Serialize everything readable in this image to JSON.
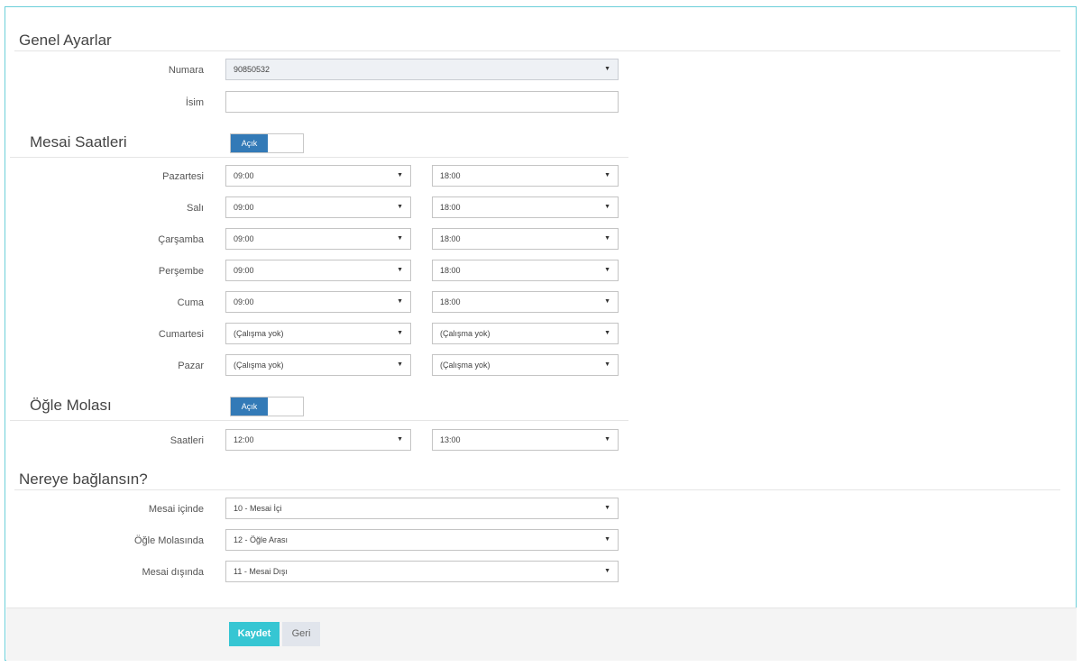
{
  "general": {
    "title": "Genel Ayarlar",
    "number_label": "Numara",
    "number_value": "90850532",
    "name_label": "İsim",
    "name_value": ""
  },
  "hours": {
    "title": "Mesai Saatleri",
    "toggle_label": "Açık",
    "days": [
      {
        "label": "Pazartesi",
        "start": "09:00",
        "end": "18:00"
      },
      {
        "label": "Salı",
        "start": "09:00",
        "end": "18:00"
      },
      {
        "label": "Çarşamba",
        "start": "09:00",
        "end": "18:00"
      },
      {
        "label": "Perşembe",
        "start": "09:00",
        "end": "18:00"
      },
      {
        "label": "Cuma",
        "start": "09:00",
        "end": "18:00"
      },
      {
        "label": "Cumartesi",
        "start": "(Çalışma yok)",
        "end": "(Çalışma yok)"
      },
      {
        "label": "Pazar",
        "start": "(Çalışma yok)",
        "end": "(Çalışma yok)"
      }
    ]
  },
  "lunch": {
    "title": "Öğle Molası",
    "toggle_label": "Açık",
    "hours_label": "Saatleri",
    "start": "12:00",
    "end": "13:00"
  },
  "routing": {
    "title": "Nereye bağlansın?",
    "items": [
      {
        "label": "Mesai içinde",
        "value": "10 - Mesai İçi"
      },
      {
        "label": "Öğle Molasında",
        "value": "12 - Öğle Arası"
      },
      {
        "label": "Mesai dışında",
        "value": "11 - Mesai Dışı"
      }
    ]
  },
  "footer": {
    "save_label": "Kaydet",
    "back_label": "Geri"
  },
  "icons": {
    "caret": "▼"
  }
}
